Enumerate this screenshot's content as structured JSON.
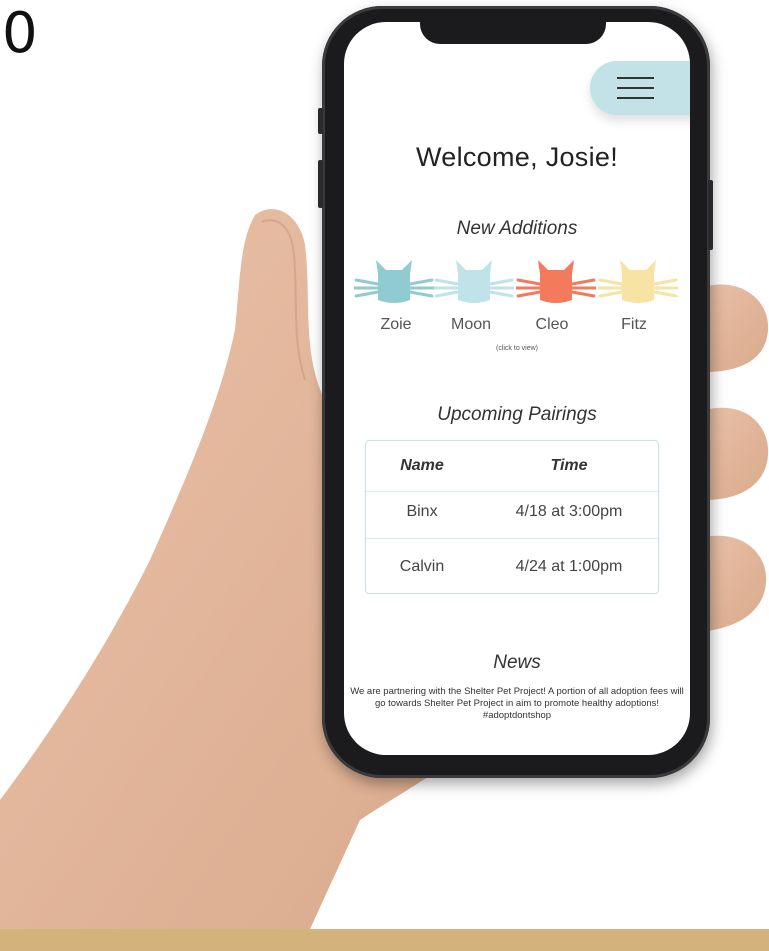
{
  "corner_label": "0",
  "app": {
    "menu_icon": "hamburger-menu-icon",
    "welcome": "Welcome, Josie!",
    "new_additions": {
      "title": "New Additions",
      "hint": "(click to view)",
      "cats": [
        {
          "name": "Zoie",
          "color": "#8fcbd1"
        },
        {
          "name": "Moon",
          "color": "#bfe3e8"
        },
        {
          "name": "Cleo",
          "color": "#f37a5a"
        },
        {
          "name": "Fitz",
          "color": "#f7e3a4"
        }
      ]
    },
    "pairings": {
      "title": "Upcoming Pairings",
      "headers": {
        "name": "Name",
        "time": "Time"
      },
      "rows": [
        {
          "name": "Binx",
          "time": "4/18 at 3:00pm"
        },
        {
          "name": "Calvin",
          "time": "4/24 at 1:00pm"
        }
      ]
    },
    "news": {
      "title": "News",
      "text": "We are partnering with the Shelter Pet Project! A portion of all adoption fees will go towards Shelter Pet Project in aim to promote healthy adoptions! #adoptdontshop"
    }
  },
  "colors": {
    "menu_bg": "#c3e2e7",
    "table_border": "#c7e3e8",
    "bottom_bar": "#d3b27c"
  }
}
